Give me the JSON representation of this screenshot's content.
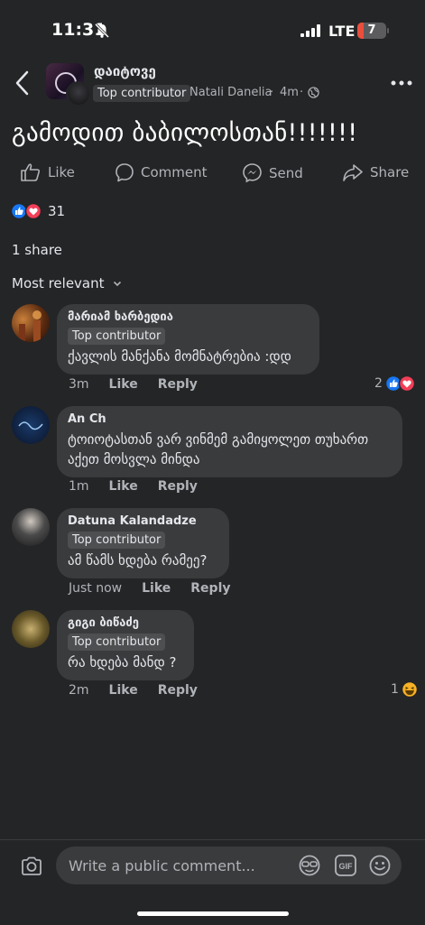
{
  "status": {
    "time": "11:31",
    "network": "LTE",
    "battery": "7"
  },
  "header": {
    "group_name": "დაიტოვე",
    "badge": "Top contributor",
    "author": "Natali Danelia",
    "separator": "·",
    "time": "4m"
  },
  "post": {
    "text": "გამოდით ბაბილოსთან!!!!!!!",
    "actions": {
      "like": "Like",
      "comment": "Comment",
      "send": "Send",
      "share": "Share"
    },
    "reaction_count": "31",
    "shares": "1 share",
    "sort_label": "Most relevant"
  },
  "comments": [
    {
      "name": "მარიამ ხარბედია",
      "badge": "Top contributor",
      "text": "ქავლის მანქანა მომნატრებია :დდ",
      "time": "3m",
      "like": "Like",
      "reply": "Reply",
      "reaction_count": "2"
    },
    {
      "name": "An Ch",
      "text_line1": "ტოიოტასთან ვარ ვინმემ გამიყოლეთ თუხართ",
      "text_line2": "აქეთ მოსვლა მინდა",
      "time": "1m",
      "like": "Like",
      "reply": "Reply"
    },
    {
      "name": "Datuna Kalandadze",
      "badge": "Top contributor",
      "text": "ამ წამს ხდება რამეე?",
      "time": "Just now",
      "like": "Like",
      "reply": "Reply"
    },
    {
      "name": "გიგი ბიწაძე",
      "badge": "Top contributor",
      "text": "რა ხდება მანდ ?",
      "time": "2m",
      "like": "Like",
      "reply": "Reply",
      "reaction_count": "1"
    }
  ],
  "composer": {
    "placeholder": "Write a public comment..."
  },
  "colors": {
    "background": "#242526",
    "bubble": "#3a3b3c",
    "like_blue": "#1877f2",
    "love_red": "#f33e58",
    "secondary_text": "#b0b3b8"
  }
}
